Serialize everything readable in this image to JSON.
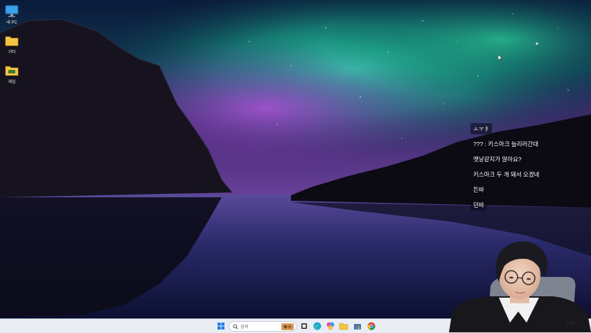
{
  "desktop": {
    "icons": [
      {
        "label": "내 PC",
        "icon": "monitor-icon"
      },
      {
        "label": "기타",
        "icon": "folder-icon"
      },
      {
        "label": "게임",
        "icon": "folder-icon"
      }
    ]
  },
  "chat": {
    "lines": [
      "ㅗㅜㅑ",
      "??? : 키스마크 늘리러간대",
      "옛날같지가 않아요?",
      "키스마크 두 개 돼서 오겠네",
      "든바",
      "던바"
    ]
  },
  "taskbar": {
    "search_placeholder": "검색",
    "apps": [
      "windows-start-icon",
      "search-icon",
      "widget-icon",
      "task-view-icon",
      "edge-icon",
      "copilot-icon",
      "file-explorer-icon",
      "store-icon",
      "chrome-icon"
    ],
    "clock_time": "6:46"
  },
  "colors": {
    "aurora_green": "#1fd6a0",
    "aurora_purple": "#7a3fb0",
    "sky_dark": "#0b1538",
    "taskbar_bg": "#e9edf3"
  }
}
